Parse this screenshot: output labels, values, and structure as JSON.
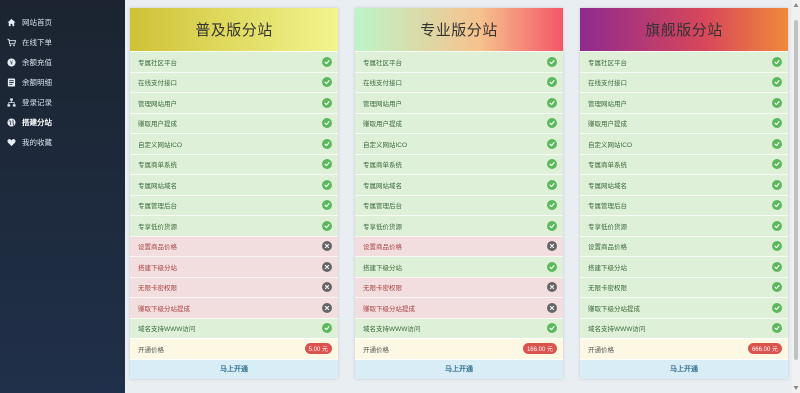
{
  "sidebar": {
    "items": [
      {
        "label": "网站首页",
        "icon": "home-icon"
      },
      {
        "label": "在线下单",
        "icon": "cart-icon"
      },
      {
        "label": "余额充值",
        "icon": "recharge-icon"
      },
      {
        "label": "余额明细",
        "icon": "list-icon"
      },
      {
        "label": "登录记录",
        "icon": "sitemap-icon"
      },
      {
        "label": "搭建分站",
        "icon": "globe-icon"
      },
      {
        "label": "我的收藏",
        "icon": "heart-icon"
      }
    ],
    "active_index": 5
  },
  "plans": [
    {
      "title": "普及版分站",
      "features": [
        {
          "label": "专属社区平台",
          "ok": true
        },
        {
          "label": "在线支付接口",
          "ok": true
        },
        {
          "label": "管理网站用户",
          "ok": true
        },
        {
          "label": "赚取用户提成",
          "ok": true
        },
        {
          "label": "自定义网站ICO",
          "ok": true
        },
        {
          "label": "专属商单系统",
          "ok": true
        },
        {
          "label": "专属网站域名",
          "ok": true
        },
        {
          "label": "专属管理后台",
          "ok": true
        },
        {
          "label": "专享低价货源",
          "ok": true
        },
        {
          "label": "设置商品价格",
          "ok": false
        },
        {
          "label": "搭建下级分站",
          "ok": false
        },
        {
          "label": "无限卡密权限",
          "ok": false
        },
        {
          "label": "赚取下级分站提成",
          "ok": false
        },
        {
          "label": "域名支持WWW访问",
          "ok": true
        }
      ],
      "price_label": "开通价格",
      "price": "5.00 元",
      "button": "马上开通"
    },
    {
      "title": "专业版分站",
      "features": [
        {
          "label": "专属社区平台",
          "ok": true
        },
        {
          "label": "在线支付接口",
          "ok": true
        },
        {
          "label": "管理网站用户",
          "ok": true
        },
        {
          "label": "赚取用户提成",
          "ok": true
        },
        {
          "label": "自定义网站ICO",
          "ok": true
        },
        {
          "label": "专属商单系统",
          "ok": true
        },
        {
          "label": "专属网站域名",
          "ok": true
        },
        {
          "label": "专属管理后台",
          "ok": true
        },
        {
          "label": "专享低价货源",
          "ok": true
        },
        {
          "label": "设置商品价格",
          "ok": false
        },
        {
          "label": "搭建下级分站",
          "ok": true
        },
        {
          "label": "无限卡密权限",
          "ok": false
        },
        {
          "label": "赚取下级分站提成",
          "ok": false
        },
        {
          "label": "域名支持WWW访问",
          "ok": true
        }
      ],
      "price_label": "开通价格",
      "price": "166.00 元",
      "button": "马上开通"
    },
    {
      "title": "旗舰版分站",
      "features": [
        {
          "label": "专属社区平台",
          "ok": true
        },
        {
          "label": "在线支付接口",
          "ok": true
        },
        {
          "label": "管理网站用户",
          "ok": true
        },
        {
          "label": "赚取用户提成",
          "ok": true
        },
        {
          "label": "自定义网站ICO",
          "ok": true
        },
        {
          "label": "专属商单系统",
          "ok": true
        },
        {
          "label": "专属网站域名",
          "ok": true
        },
        {
          "label": "专属管理后台",
          "ok": true
        },
        {
          "label": "专享低价货源",
          "ok": true
        },
        {
          "label": "设置商品价格",
          "ok": true
        },
        {
          "label": "搭建下级分站",
          "ok": true
        },
        {
          "label": "无限卡密权限",
          "ok": true
        },
        {
          "label": "赚取下级分站提成",
          "ok": true
        },
        {
          "label": "域名支持WWW访问",
          "ok": true
        }
      ],
      "price_label": "开通价格",
      "price": "666.00 元",
      "button": "马上开通"
    }
  ]
}
